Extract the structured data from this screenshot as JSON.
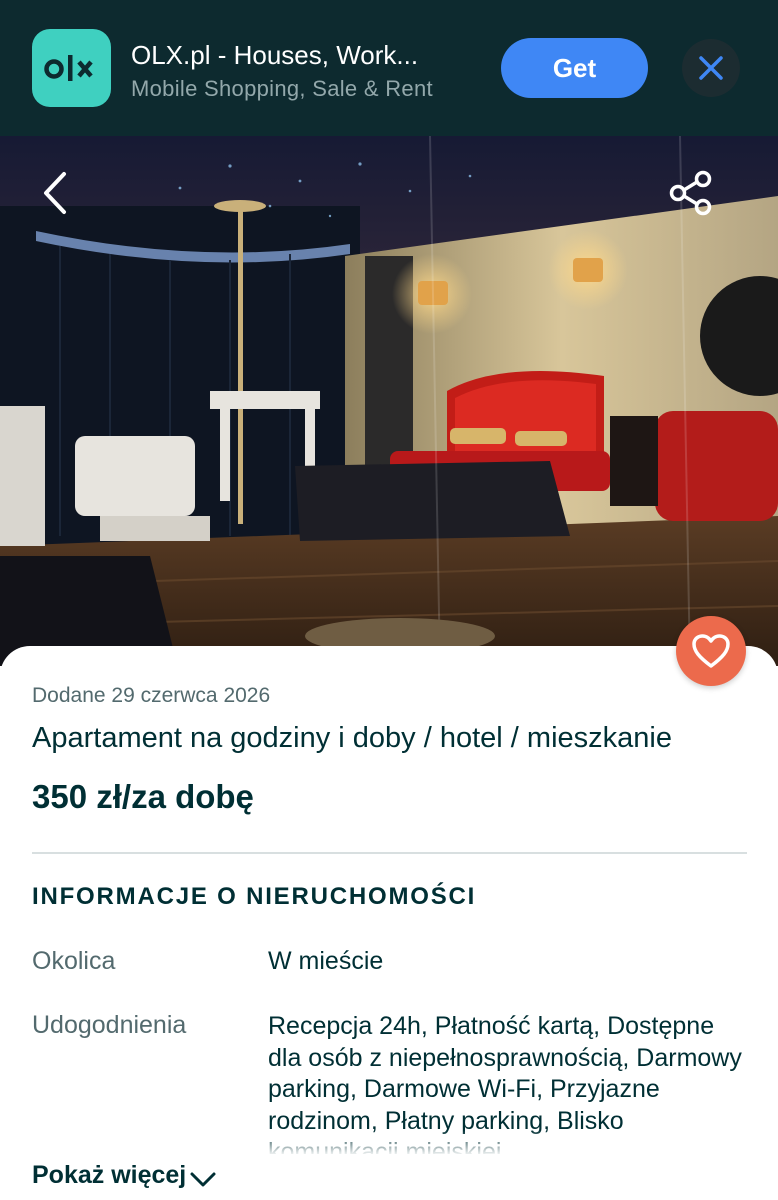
{
  "banner": {
    "app_name": "OLX.pl - Houses, Work...",
    "app_subtitle": "Mobile Shopping, Sale & Rent",
    "get_label": "Get",
    "logo_text": "OLX",
    "logo_color": "#3fd0c0",
    "get_color": "#3f87f5",
    "close_icon": "close-icon"
  },
  "photo": {
    "back_icon": "chevron-left-icon",
    "share_icon": "share-icon"
  },
  "favorite": {
    "icon": "heart-icon",
    "color": "#ec6a4c"
  },
  "listing": {
    "date": "Dodane 29 czerwca 2026",
    "title": "Apartament na godziny i doby / hotel / mieszkanie",
    "price": "350 zł/za dobę"
  },
  "details": {
    "heading": "INFORMACJE O NIERUCHOMOŚCI",
    "rows": [
      {
        "label": "Okolica",
        "value": "W mieście"
      },
      {
        "label": "Udogodnienia",
        "value": "Recepcja 24h, Płatność kartą, Dostępne dla osób z niepełnosprawnością, Darmowy parking, Darmowe Wi-Fi, Przyjazne rodzinom, Płatny parking, Blisko komunikacji miejskiej"
      }
    ],
    "show_more": "Pokaż więcej"
  }
}
